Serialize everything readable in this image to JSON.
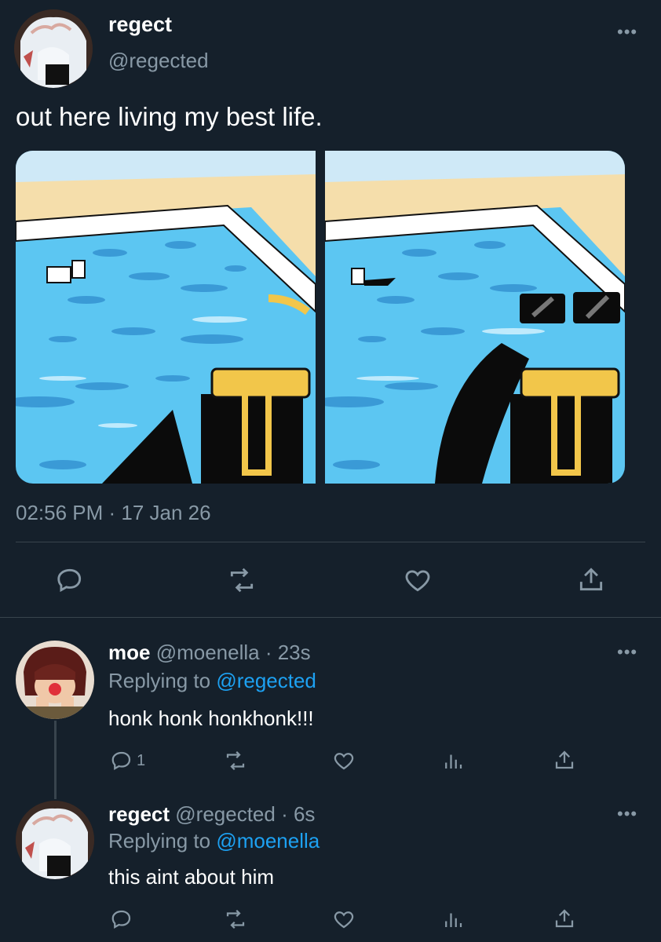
{
  "main_tweet": {
    "author_name": "regect",
    "author_handle": "@regected",
    "text": "out here living my best life.",
    "timestamp": "02:56 PM · 17 Jan 26",
    "more_label": "•••"
  },
  "replies": [
    {
      "author_name": "moe",
      "author_handle": "@moenella",
      "age": "· 23s",
      "replying_prefix": "Replying to",
      "replying_to": "@regected",
      "text": "honk honk honkhonk!!!",
      "reply_count": "1",
      "more_label": "•••"
    },
    {
      "author_name": "regect",
      "author_handle": "@regected",
      "age": "· 6s",
      "replying_prefix": "Replying to",
      "replying_to": "@moenella",
      "text": "this aint about him",
      "more_label": "•••"
    }
  ],
  "icons": [
    "reply-icon",
    "retweet-icon",
    "like-icon",
    "share-icon",
    "analytics-icon",
    "more-icon"
  ],
  "colors": {
    "background": "#15202b",
    "secondary_text": "#8899a6",
    "link": "#1da1f2",
    "divider": "#38444d"
  }
}
